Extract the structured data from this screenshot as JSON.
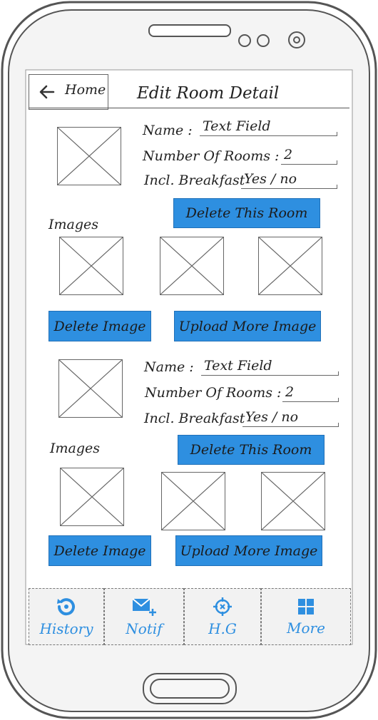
{
  "header": {
    "back_label": "Home",
    "title": "Edit Room Detail"
  },
  "rooms": [
    {
      "name_label": "Name :",
      "name_value": "Text Field",
      "rooms_label": "Number Of Rooms :",
      "rooms_value": "2",
      "breakfast_label": "Incl. Breakfast",
      "breakfast_value": "Yes / no",
      "delete_room_label": "Delete This Room",
      "images_label": "Images",
      "delete_image_label": "Delete Image",
      "upload_label": "Upload More Image"
    },
    {
      "name_label": "Name :",
      "name_value": "Text Field",
      "rooms_label": "Number Of Rooms :",
      "rooms_value": "2",
      "breakfast_label": "Incl. Breakfast",
      "breakfast_value": "Yes / no",
      "delete_room_label": "Delete This Room",
      "images_label": "Images",
      "delete_image_label": "Delete Image",
      "upload_label": "Upload More Image"
    }
  ],
  "tabs": [
    {
      "label": "History",
      "icon": "history-icon"
    },
    {
      "label": "Notif",
      "icon": "mail-plus-icon"
    },
    {
      "label": "H.G",
      "icon": "crosshair-icon"
    },
    {
      "label": "More",
      "icon": "grid-icon"
    }
  ],
  "colors": {
    "accent": "#2e8fe0",
    "outline": "#666666"
  }
}
